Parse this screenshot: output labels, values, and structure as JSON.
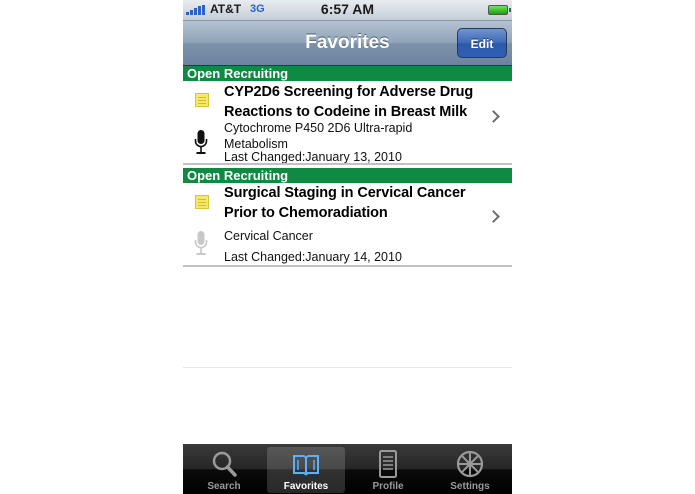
{
  "status_bar": {
    "carrier": "AT&T",
    "network": "3G",
    "time": "6:57 AM"
  },
  "nav": {
    "title": "Favorites",
    "edit_label": "Edit"
  },
  "favorites": [
    {
      "status": "Open Recruiting",
      "title_line1": "CYP2D6 Screening for Adverse Drug",
      "title_line2": "Reactions to Codeine in Breast Milk",
      "condition_line1": "Cytochrome P450 2D6 Ultra-rapid",
      "condition_line2": "Metabolism",
      "last_changed": "Last Changed:January 13, 2010",
      "audio": "available"
    },
    {
      "status": "Open Recruiting",
      "title_line1": "Surgical Staging in Cervical Cancer",
      "title_line2": "Prior to Chemoradiation",
      "condition_line1": "Cervical Cancer",
      "last_changed": "Last Changed:January 14, 2010",
      "audio": "unavailable"
    }
  ],
  "tabs": [
    {
      "label": "Search",
      "icon": "search-icon",
      "selected": false
    },
    {
      "label": "Favorites",
      "icon": "book-icon",
      "selected": true
    },
    {
      "label": "Profile",
      "icon": "profile-icon",
      "selected": false
    },
    {
      "label": "Settings",
      "icon": "settings-icon",
      "selected": false
    }
  ],
  "colors": {
    "section_header": "#0e8a43",
    "nav_bar": "#8fa2b7",
    "edit_button": "#3e69b4",
    "note": "#f6e76a"
  }
}
